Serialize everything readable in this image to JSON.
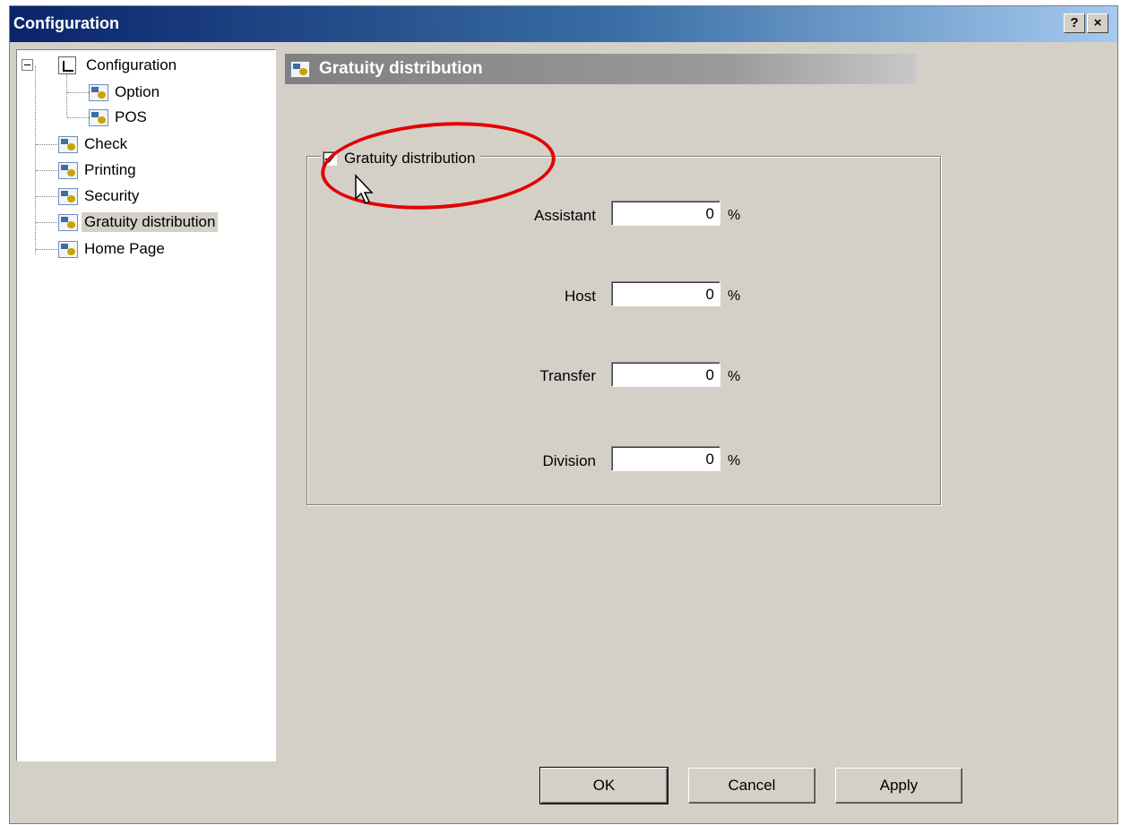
{
  "window": {
    "title": "Configuration",
    "help_button": "?",
    "close_button": "×"
  },
  "tree": {
    "items": [
      {
        "label": "Configuration"
      },
      {
        "label": "Option"
      },
      {
        "label": "POS"
      },
      {
        "label": "Check"
      },
      {
        "label": "Printing"
      },
      {
        "label": "Security"
      },
      {
        "label": "Gratuity distribution"
      },
      {
        "label": "Home Page"
      }
    ],
    "selected": "Gratuity distribution"
  },
  "panel": {
    "header": "Gratuity distribution",
    "group_label": "Gratuity distribution",
    "group_checked": true,
    "fields": [
      {
        "label": "Assistant",
        "value": "0",
        "unit": "%"
      },
      {
        "label": "Host",
        "value": "0",
        "unit": "%"
      },
      {
        "label": "Transfer",
        "value": "0",
        "unit": "%"
      },
      {
        "label": "Division",
        "value": "0",
        "unit": "%"
      }
    ]
  },
  "buttons": {
    "ok": "OK",
    "cancel": "Cancel",
    "apply": "Apply"
  },
  "annotation": {
    "color": "#e30000"
  }
}
